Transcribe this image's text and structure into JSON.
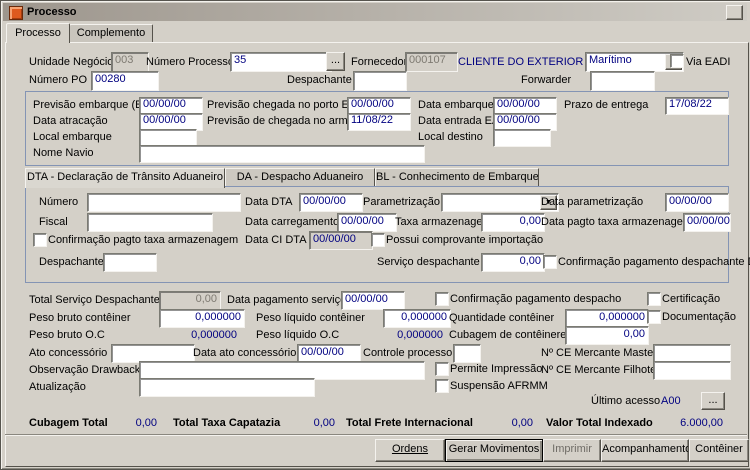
{
  "window": {
    "title": "Processo",
    "tabs": [
      {
        "label": "Processo"
      },
      {
        "label": "Complemento"
      }
    ]
  },
  "header": {
    "unidade_negocio": {
      "label": "Unidade Negócio",
      "value": "003"
    },
    "numero_processo": {
      "label": "Número Processo",
      "value": "35"
    },
    "fornecedor": {
      "label": "Fornecedor",
      "code": "000107",
      "name": "CLIENTE DO EXTERIOR EU"
    },
    "modal": {
      "value": "Marítimo"
    },
    "via_eadi": {
      "label": "Via EADI",
      "checked": false
    },
    "numero_po": {
      "label": "Número PO",
      "value": "00280"
    },
    "despachante": {
      "label": "Despachante",
      "value": ""
    },
    "forwarder": {
      "label": "Forwarder",
      "value": ""
    }
  },
  "embarque": {
    "previsao_embarque": {
      "label": "Previsão embarque (ETD)",
      "value": "00/00/00"
    },
    "previsao_chegada_porto": {
      "label": "Previsão chegada no porto ETA",
      "value": "00/00/00"
    },
    "data_embarque": {
      "label": "Data embarque",
      "value": "00/00/00"
    },
    "prazo_entrega": {
      "label": "Prazo de entrega",
      "value": "17/08/22"
    },
    "data_atracacao": {
      "label": "Data atracação",
      "value": "00/00/00"
    },
    "previsao_chegada_armazem": {
      "label": "Previsão de chegada no armazém",
      "value": "11/08/22"
    },
    "data_entrada_eadi": {
      "label": "Data entrada EADI",
      "value": "00/00/00"
    },
    "local_embarque": {
      "label": "Local embarque",
      "value": ""
    },
    "local_destino": {
      "label": "Local destino",
      "value": ""
    },
    "nome_navio": {
      "label": "Nome Navio",
      "value": ""
    }
  },
  "subtabs": [
    {
      "label": "DTA - Declaração de Trânsito Aduaneiro",
      "active": true
    },
    {
      "label": "DA - Despacho Aduaneiro",
      "active": false
    },
    {
      "label": "BL - Conhecimento de Embarque",
      "active": false
    }
  ],
  "dta": {
    "numero": {
      "label": "Número",
      "value": ""
    },
    "data_dta": {
      "label": "Data DTA",
      "value": "00/00/00"
    },
    "parametrizacao": {
      "label": "Parametrização",
      "value": ""
    },
    "data_parametrizacao": {
      "label": "Data parametrização",
      "value": "00/00/00"
    },
    "fiscal": {
      "label": "Fiscal",
      "value": ""
    },
    "data_carregamento": {
      "label": "Data carregamento",
      "value": "00/00/00"
    },
    "taxa_armazenagem": {
      "label": "Taxa armazenagem",
      "value": "0,00"
    },
    "data_pagto_taxa": {
      "label": "Data pagto taxa armazenagem",
      "value": "00/00/00"
    },
    "confirmacao_pagto_taxa": {
      "label": "Confirmação pagto taxa armazenagem",
      "checked": false
    },
    "data_ci_dta": {
      "label": "Data CI DTA",
      "value": "00/00/00"
    },
    "possui_comprovante": {
      "label": "Possui comprovante importação",
      "checked": false
    },
    "despachante": {
      "label": "Despachante",
      "value": ""
    },
    "servico_despachante": {
      "label": "Serviço despachante",
      "value": "0,00"
    },
    "confirmacao_pagamento_despachante": {
      "label": "Confirmação pagamento despachante DTA",
      "checked": false
    }
  },
  "detalhes": {
    "total_servico_despachante": {
      "label": "Total Serviço Despachante",
      "value": "0,00"
    },
    "data_pagamento_servico": {
      "label": "Data pagamento serviço",
      "value": "00/00/00"
    },
    "confirmacao_pagamento_despacho": {
      "label": "Confirmação pagamento despacho",
      "checked": false
    },
    "certificacao": {
      "label": "Certificação",
      "checked": false
    },
    "peso_bruto_conteiner": {
      "label": "Peso bruto contêiner",
      "value": "0,000000"
    },
    "peso_liquido_conteiner": {
      "label": "Peso líquido contêiner",
      "value": "0,000000"
    },
    "quantidade_conteiner": {
      "label": "Quantidade contêiner",
      "value": "0,000000"
    },
    "documentacao": {
      "label": "Documentação",
      "checked": false
    },
    "peso_bruto_oc": {
      "label": "Peso bruto O.C",
      "value": "0,000000"
    },
    "peso_liquido_oc": {
      "label": "Peso líquido O.C",
      "value": "0,000000"
    },
    "cubagem_conteineres": {
      "label": "Cubagem de contêineres",
      "value": "0,00"
    },
    "ato_concessorio": {
      "label": "Ato concessório",
      "value": ""
    },
    "data_ato_concessorio": {
      "label": "Data ato concessório",
      "value": "00/00/00"
    },
    "controle_processo": {
      "label": "Controle processo",
      "value": ""
    },
    "ce_mercante_master": {
      "label": "Nº CE Mercante Master",
      "value": ""
    },
    "observacao_drawback": {
      "label": "Observação Drawback",
      "value": ""
    },
    "permite_impressao": {
      "label": "Permite Impressão",
      "checked": false
    },
    "ce_mercante_filhote": {
      "label": "Nº CE Mercante Filhote",
      "value": ""
    },
    "atualizacao": {
      "label": "Atualização",
      "value": ""
    },
    "suspensao_afrmm": {
      "label": "Suspensão AFRMM",
      "checked": false
    },
    "ultimo_acesso": {
      "label": "Último acesso",
      "value": "A00"
    }
  },
  "footer": {
    "cubagem_total": {
      "label": "Cubagem Total",
      "value": "0,00"
    },
    "total_taxa_capatazia": {
      "label": "Total Taxa Capatazia",
      "value": "0,00"
    },
    "total_frete_internacional": {
      "label": "Total Frete Internacional",
      "value": "0,00"
    },
    "valor_total_indexado": {
      "label": "Valor Total Indexado",
      "value": "6.000,00"
    }
  },
  "actions": {
    "ordens": "Ordens",
    "gerar_movimentos": "Gerar Movimentos",
    "imprimir": "Imprimir",
    "acompanhamento": "Acompanhamento",
    "conteiner": "Contêiner"
  },
  "misc": {
    "browse": "...",
    "dropdown_arrow": "▼"
  }
}
